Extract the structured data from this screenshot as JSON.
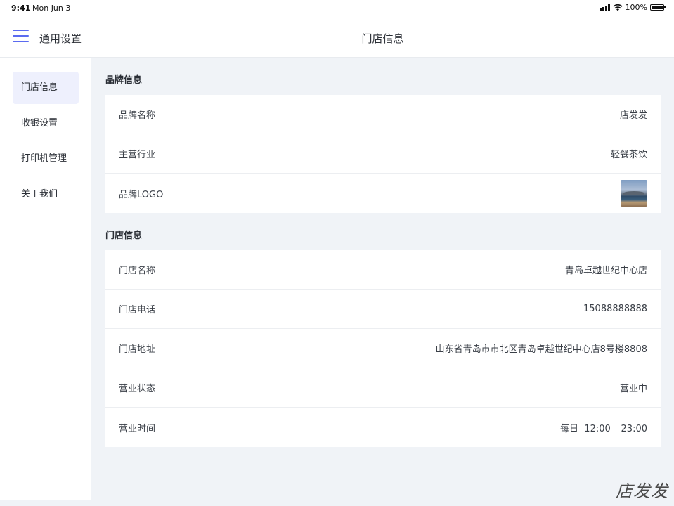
{
  "status_bar": {
    "time": "9:41",
    "date": "Mon Jun 3",
    "battery": "100%"
  },
  "nav": {
    "left_label": "通用设置",
    "title": "门店信息"
  },
  "sidebar": {
    "items": [
      {
        "label": "门店信息",
        "active": true
      },
      {
        "label": "收银设置",
        "active": false
      },
      {
        "label": "打印机管理",
        "active": false
      },
      {
        "label": "关于我们",
        "active": false
      }
    ]
  },
  "brand": {
    "section_title": "品牌信息",
    "rows": [
      {
        "label": "品牌名称",
        "value": "店发发"
      },
      {
        "label": "主营行业",
        "value": "轻餐茶饮"
      },
      {
        "label": "品牌LOGO",
        "value": ""
      }
    ]
  },
  "store": {
    "section_title": "门店信息",
    "rows": [
      {
        "label": "门店名称",
        "value": "青岛卓越世纪中心店"
      },
      {
        "label": "门店电话",
        "value": "15088888888"
      },
      {
        "label": "门店地址",
        "value": "山东省青岛市市北区青岛卓越世纪中心店8号楼8808"
      },
      {
        "label": "营业状态",
        "value": "营业中"
      },
      {
        "label": "营业时间",
        "value": "每日  12:00 – 23:00"
      }
    ]
  },
  "watermark": "店发发",
  "colors": {
    "accent": "#5b6bf0",
    "active_bg": "#eef0fd",
    "page_bg": "#f0f3f7"
  }
}
